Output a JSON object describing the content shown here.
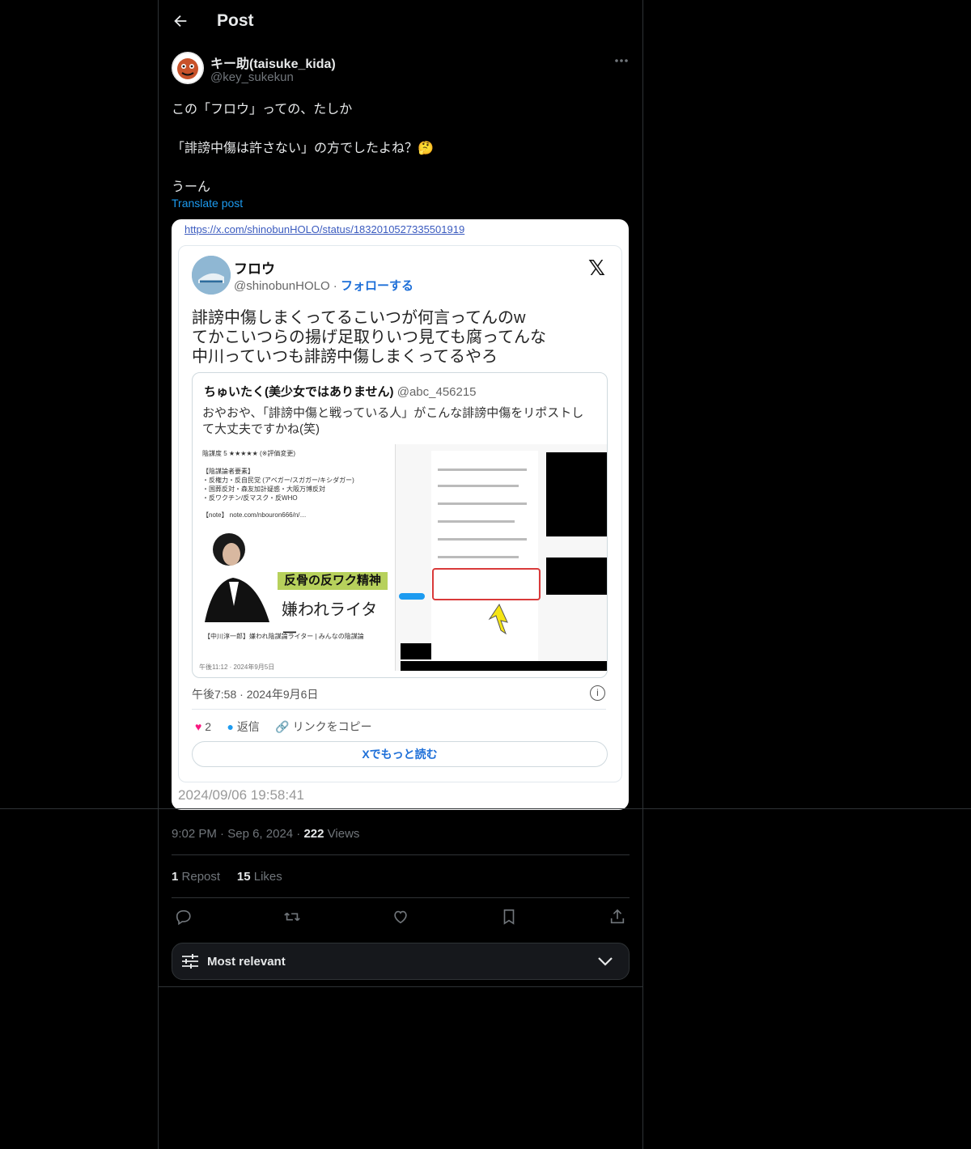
{
  "header": {
    "title": "Post",
    "back_icon": "arrow-left-icon"
  },
  "author": {
    "display_name": "キー助(taisuke_kida)",
    "handle": "@key_sukekun"
  },
  "tweet": {
    "lines": [
      "この「フロウ」っての、たしか",
      "「誹謗中傷は許さない」の方でしたよね？🤔",
      "うーん"
    ],
    "translate_label": "Translate post"
  },
  "attachment": {
    "url_text": "https://x.com/shinobunHOLO/status/1832010527335501919",
    "embed": {
      "name": "フロウ",
      "handle": "@shinobunHOLO",
      "follow": "フォローする",
      "text_lines": [
        "誹謗中傷しまくってるこいつが何言ってんのw",
        "てかこいつらの揚げ足取りいつ見ても腐ってんな",
        "中川っていつも誹謗中傷しまくってるやろ"
      ],
      "quote": {
        "name": "ちゅいたく(美少女ではありません)",
        "handle": "@abc_456215",
        "text_lines": [
          "おやおや、「誹謗中傷と戦っている人」がこんな誹謗中傷をリポストし",
          "て大丈夫ですかね(笑)"
        ],
        "left_panel": {
          "lines": [
            "陰謀度 5 ★★★★★ (※評価変更)",
            "【陰謀論者要素】",
            "・反権力・反自民党 (アベガー/スガガー/キシダガー)",
            "・国葬反対・森友加計疑惑・大阪万博反対",
            "・反ワクチン/反マスク・反WHO",
            "【note】 note.com/nbouron666/n/…"
          ],
          "banner_top": "反骨の反ワク精神",
          "banner_bottom": "嫌われライター",
          "footer": "【中川淳一郎】嫌われ陰謀論ライター | みんなの陰謀論",
          "timestamp": "午後11:12 · 2024年9月5日"
        }
      },
      "date": "午後7:58 · 2024年9月6日",
      "likes": "2",
      "reply": "返信",
      "copy_link": "リンクをコピー",
      "read_more": "Xでもっと読む"
    },
    "capture_timestamp": "2024/09/06 19:58:41"
  },
  "meta": {
    "time": "9:02 PM",
    "date": "Sep 6, 2024",
    "views_count": "222",
    "views_label": "Views"
  },
  "stats": {
    "reposts_count": "1",
    "reposts_label": "Repost",
    "likes_count": "15",
    "likes_label": "Likes"
  },
  "actions": [
    "reply-icon",
    "repost-icon",
    "like-icon",
    "bookmark-icon",
    "share-icon"
  ],
  "sort": {
    "label": "Most relevant"
  },
  "colors": {
    "background": "#000000",
    "link": "#1d9bf0",
    "muted": "#71767b",
    "border": "#2f3336"
  }
}
